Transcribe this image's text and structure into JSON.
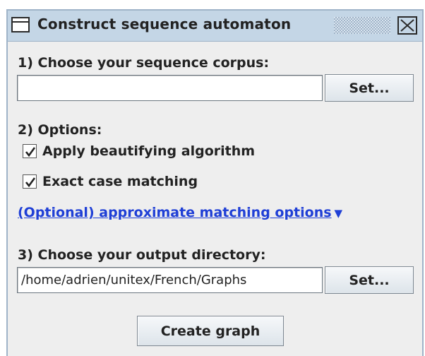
{
  "window": {
    "title": "Construct sequence automaton",
    "icons": {
      "window": "window-icon",
      "close": "close-icon"
    }
  },
  "step1": {
    "label": "1) Choose your sequence corpus:",
    "field_value": "",
    "set_button": "Set..."
  },
  "step2": {
    "label": "2) Options:",
    "options": [
      {
        "label": "Apply beautifying algorithm",
        "checked": true
      },
      {
        "label": "Exact case matching",
        "checked": true
      }
    ],
    "approx_link": "(Optional) approximate matching options",
    "approx_link_icon": "triangle-down-icon"
  },
  "step3": {
    "label": "3) Choose your output directory:",
    "field_value": "/home/adrien/unitex/French/Graphs",
    "set_button": "Set..."
  },
  "create_button": "Create graph",
  "colors": {
    "titlebar": "#c4d6e6",
    "panel": "#eeeeee",
    "link": "#1f3fd6"
  }
}
